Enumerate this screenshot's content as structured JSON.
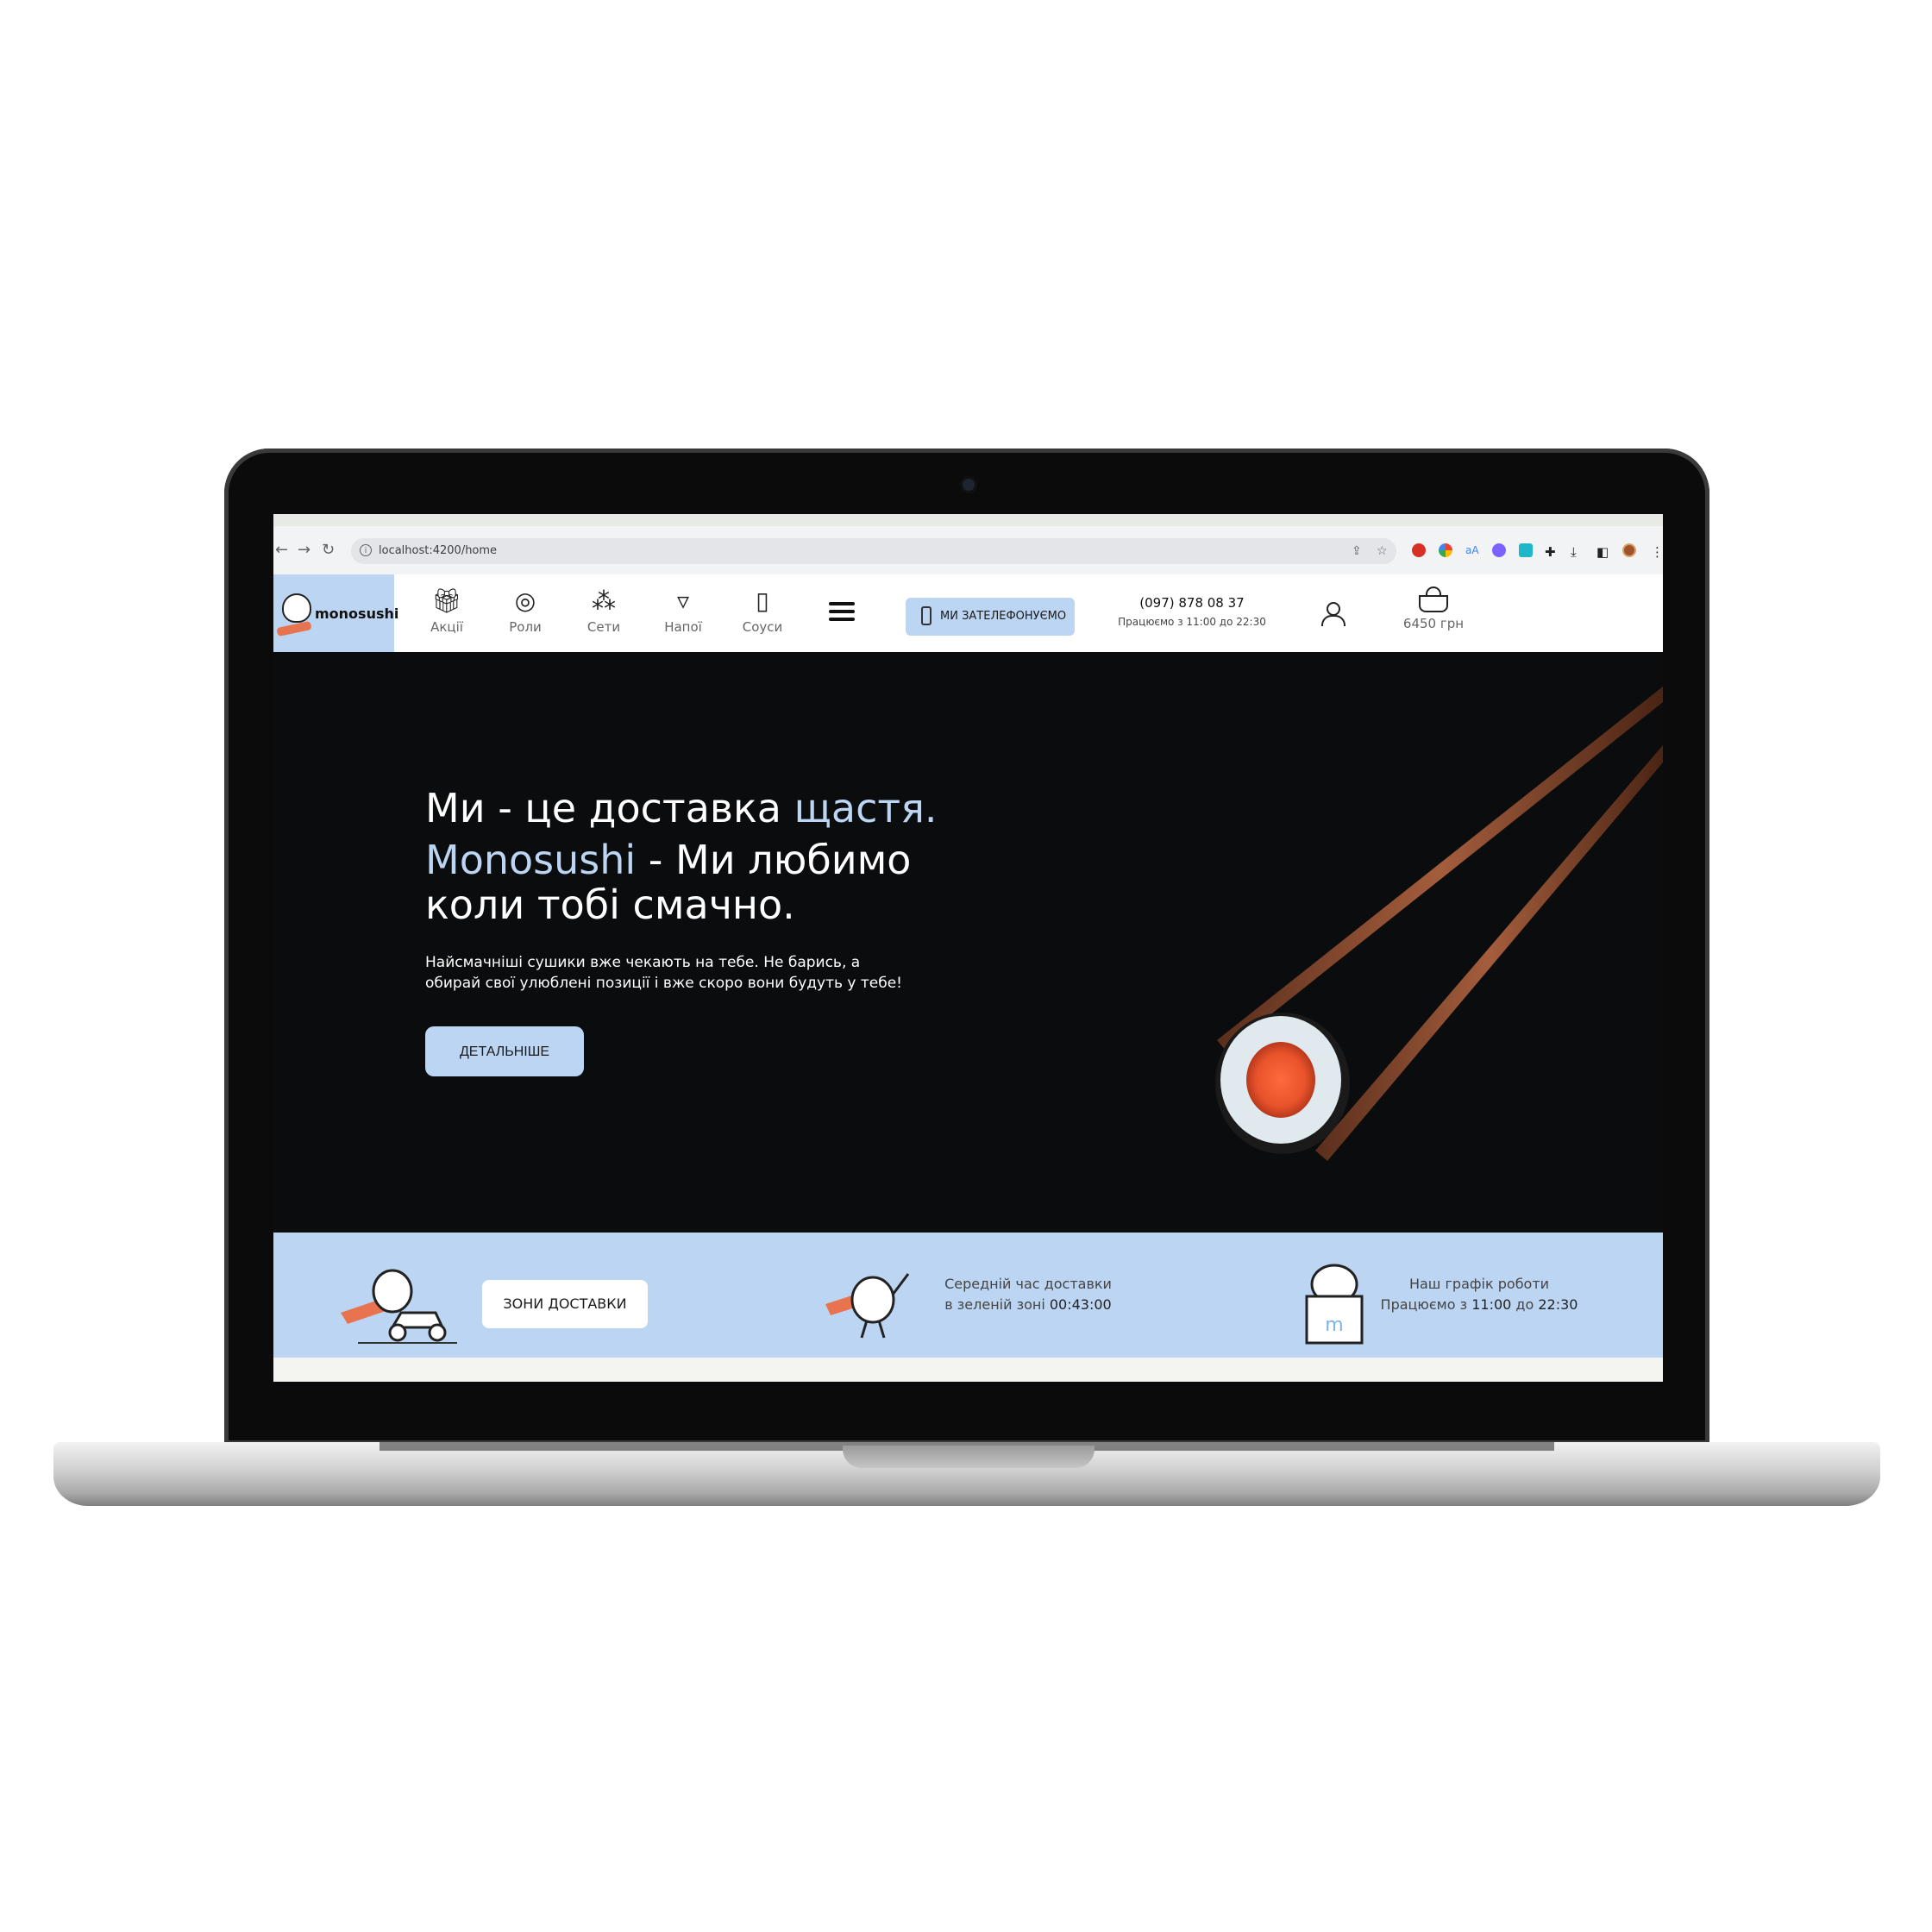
{
  "browser": {
    "url": "localhost:4200/home"
  },
  "header": {
    "logo_text": "monosushi",
    "categories": [
      {
        "label": "Акції",
        "icon": "gift-icon"
      },
      {
        "label": "Роли",
        "icon": "rolls-icon"
      },
      {
        "label": "Сети",
        "icon": "sets-icon"
      },
      {
        "label": "Напої",
        "icon": "drink-icon"
      },
      {
        "label": "Соуси",
        "icon": "sauce-icon"
      }
    ],
    "call_button": "МИ ЗАТЕЛЕФОНУЄМО",
    "phone": "(097) 878 08 37",
    "hours": "Працюємо з 11:00 до 22:30",
    "cart_total": "6450 грн"
  },
  "hero": {
    "line1_a": "Ми - це доставка ",
    "line1_b": "щастя.",
    "line2_a": "Monosushi",
    "line2_b": " - Ми любимо",
    "line3": "коли тобі смачно.",
    "subtitle": " Найсмачніші сушики вже чекають на тебе. Не барись, а обирай свої улюблені позиції і вже скоро вони будуть у тебе!",
    "button": "ДЕТАЛЬНІШЕ"
  },
  "strip": {
    "zones_button": "ЗОНИ ДОСТАВКИ",
    "delivery_line1": "Середній час доставки",
    "delivery_line2": "в зеленій зоні ",
    "delivery_time": "00:43:00",
    "schedule_line1": "Наш графік роботи",
    "schedule_line2_a": "Працюємо з ",
    "schedule_open": "11:00",
    "schedule_line2_b": " до ",
    "schedule_close": "22:30"
  },
  "colors": {
    "accent": "#bcd5f2",
    "hero_bg": "#0a0c0e",
    "salmon": "#e8734f"
  }
}
